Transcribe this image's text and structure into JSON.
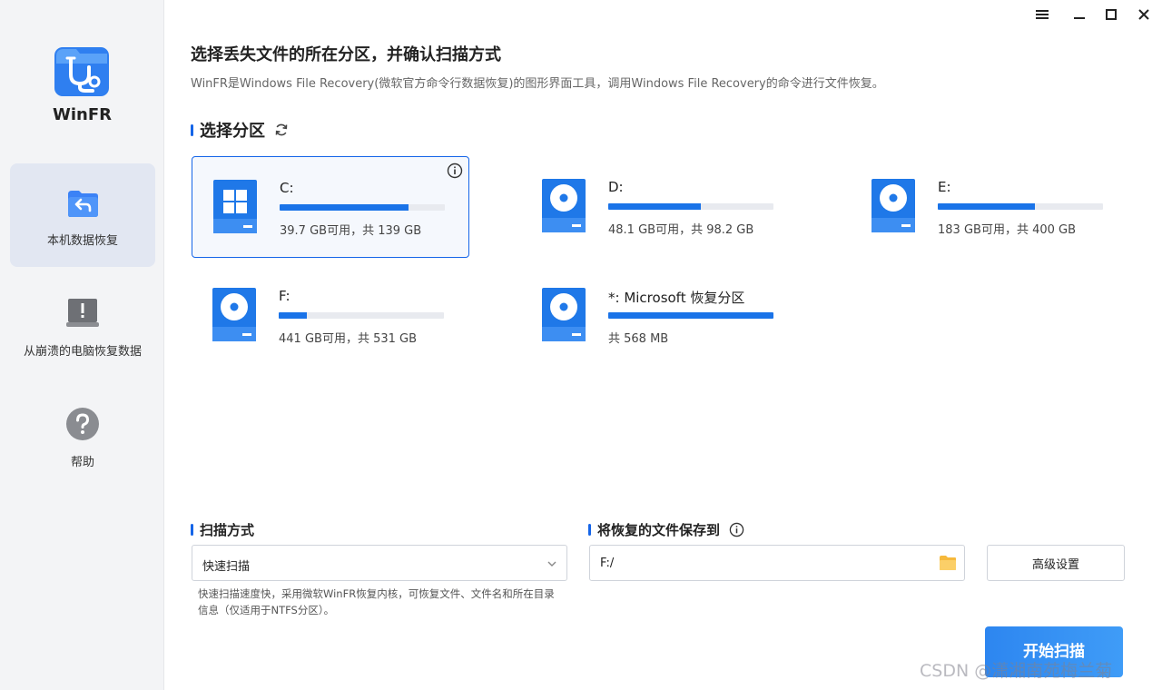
{
  "app": {
    "name": "WinFR"
  },
  "window_controls": {
    "menu": "menu",
    "minimize": "minimize",
    "maximize": "maximize",
    "close": "close"
  },
  "sidebar": {
    "items": [
      {
        "label": "本机数据恢复",
        "icon": "restore-icon",
        "active": true
      },
      {
        "label": "从崩溃的电脑恢复数据",
        "icon": "crashed-pc-icon",
        "active": false
      },
      {
        "label": "帮助",
        "icon": "help-icon",
        "active": false
      }
    ]
  },
  "header": {
    "title": "选择丢失文件的所在分区，并确认扫描方式",
    "subtitle": "WinFR是Windows File Recovery(微软官方命令行数据恢复)的图形界面工具，调用Windows File Recovery的命令进行文件恢复。"
  },
  "partitions": {
    "heading": "选择分区",
    "drives": [
      {
        "name": "C:",
        "info": "39.7 GB可用，共 139 GB",
        "used_fraction": 0.78,
        "type": "windows",
        "selected": true
      },
      {
        "name": "D:",
        "info": "48.1 GB可用，共 98.2 GB",
        "used_fraction": 0.56,
        "type": "disk",
        "selected": false
      },
      {
        "name": "E:",
        "info": "183 GB可用，共 400 GB",
        "used_fraction": 0.59,
        "type": "disk",
        "selected": false
      },
      {
        "name": "F:",
        "info": "441 GB可用，共 531 GB",
        "used_fraction": 0.17,
        "type": "disk",
        "selected": false
      },
      {
        "name": "*: Microsoft 恢复分区",
        "info": "共 568 MB",
        "used_fraction": 1.0,
        "type": "disk",
        "selected": false
      }
    ]
  },
  "scan": {
    "heading": "扫描方式",
    "selected": "快速扫描",
    "description": "快速扫描速度快，采用微软WinFR恢复内核，可恢复文件、文件名和所在目录信息（仅适用于NTFS分区）。"
  },
  "save": {
    "heading": "将恢复的文件保存到",
    "path": "F:/"
  },
  "buttons": {
    "advanced": "高级设置",
    "start": "开始扫描"
  },
  "watermark": "CSDN @潇湘南苑梅兰菊",
  "colors": {
    "accent": "#1565e8",
    "bar_fill": "#1a73e8",
    "sidebar_bg": "#f3f4f6",
    "active_nav": "#e2e7f2"
  }
}
